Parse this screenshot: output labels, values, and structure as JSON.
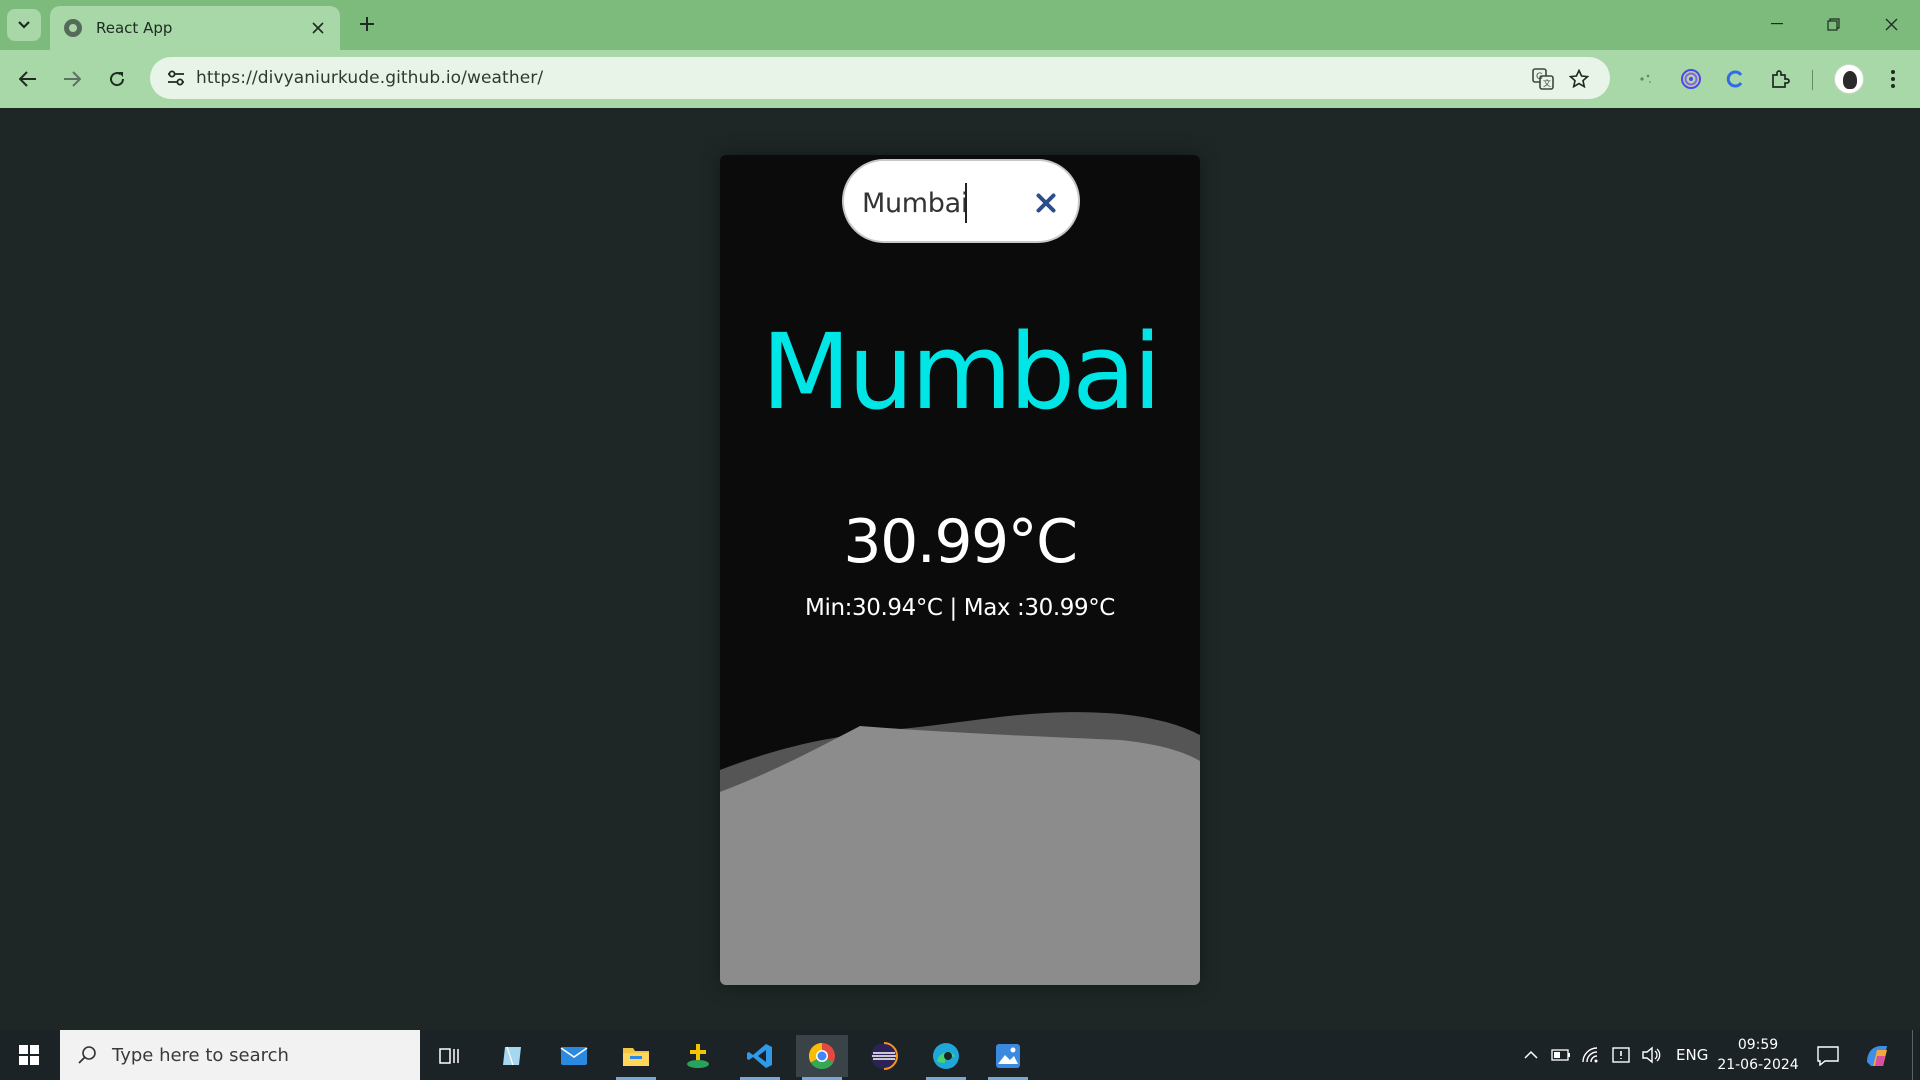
{
  "browser": {
    "tab_title": "React App",
    "url": "https://divyaniurkude.github.io/weather/",
    "icons": {
      "tab_search": "chevron-down-icon",
      "tab_favicon": "globe-icon",
      "tab_close": "close-icon",
      "new_tab": "plus-icon",
      "minimize": "minimize-icon",
      "restore": "restore-icon",
      "close_window": "close-icon",
      "back": "arrow-left-icon",
      "forward": "arrow-right-icon",
      "reload": "reload-icon",
      "site_info": "tune-icon",
      "translate": "translate-icon",
      "bookmark": "star-icon",
      "extensions": "puzzle-icon",
      "menu": "kebab-menu-icon"
    }
  },
  "weather_app": {
    "search": {
      "value": "Mumbai",
      "clear_icon": "close-icon"
    },
    "city": "Mumbai",
    "temperature": "30.99°C",
    "min_max": "Min:30.94°C | Max :30.99°C",
    "colors": {
      "city_text": "#00e5e5",
      "card_background": "#0b0b0b",
      "page_background": "#1e2626",
      "wave_back": "#555555",
      "wave_front": "#8c8c8c"
    }
  },
  "taskbar": {
    "search_placeholder": "Type here to search",
    "language": "ENG",
    "time": "09:59",
    "date": "21-06-2024",
    "apps": [
      "task-view",
      "notes",
      "mail",
      "file-explorer",
      "app",
      "vs-code",
      "chrome",
      "eclipse",
      "edge",
      "photos"
    ]
  }
}
